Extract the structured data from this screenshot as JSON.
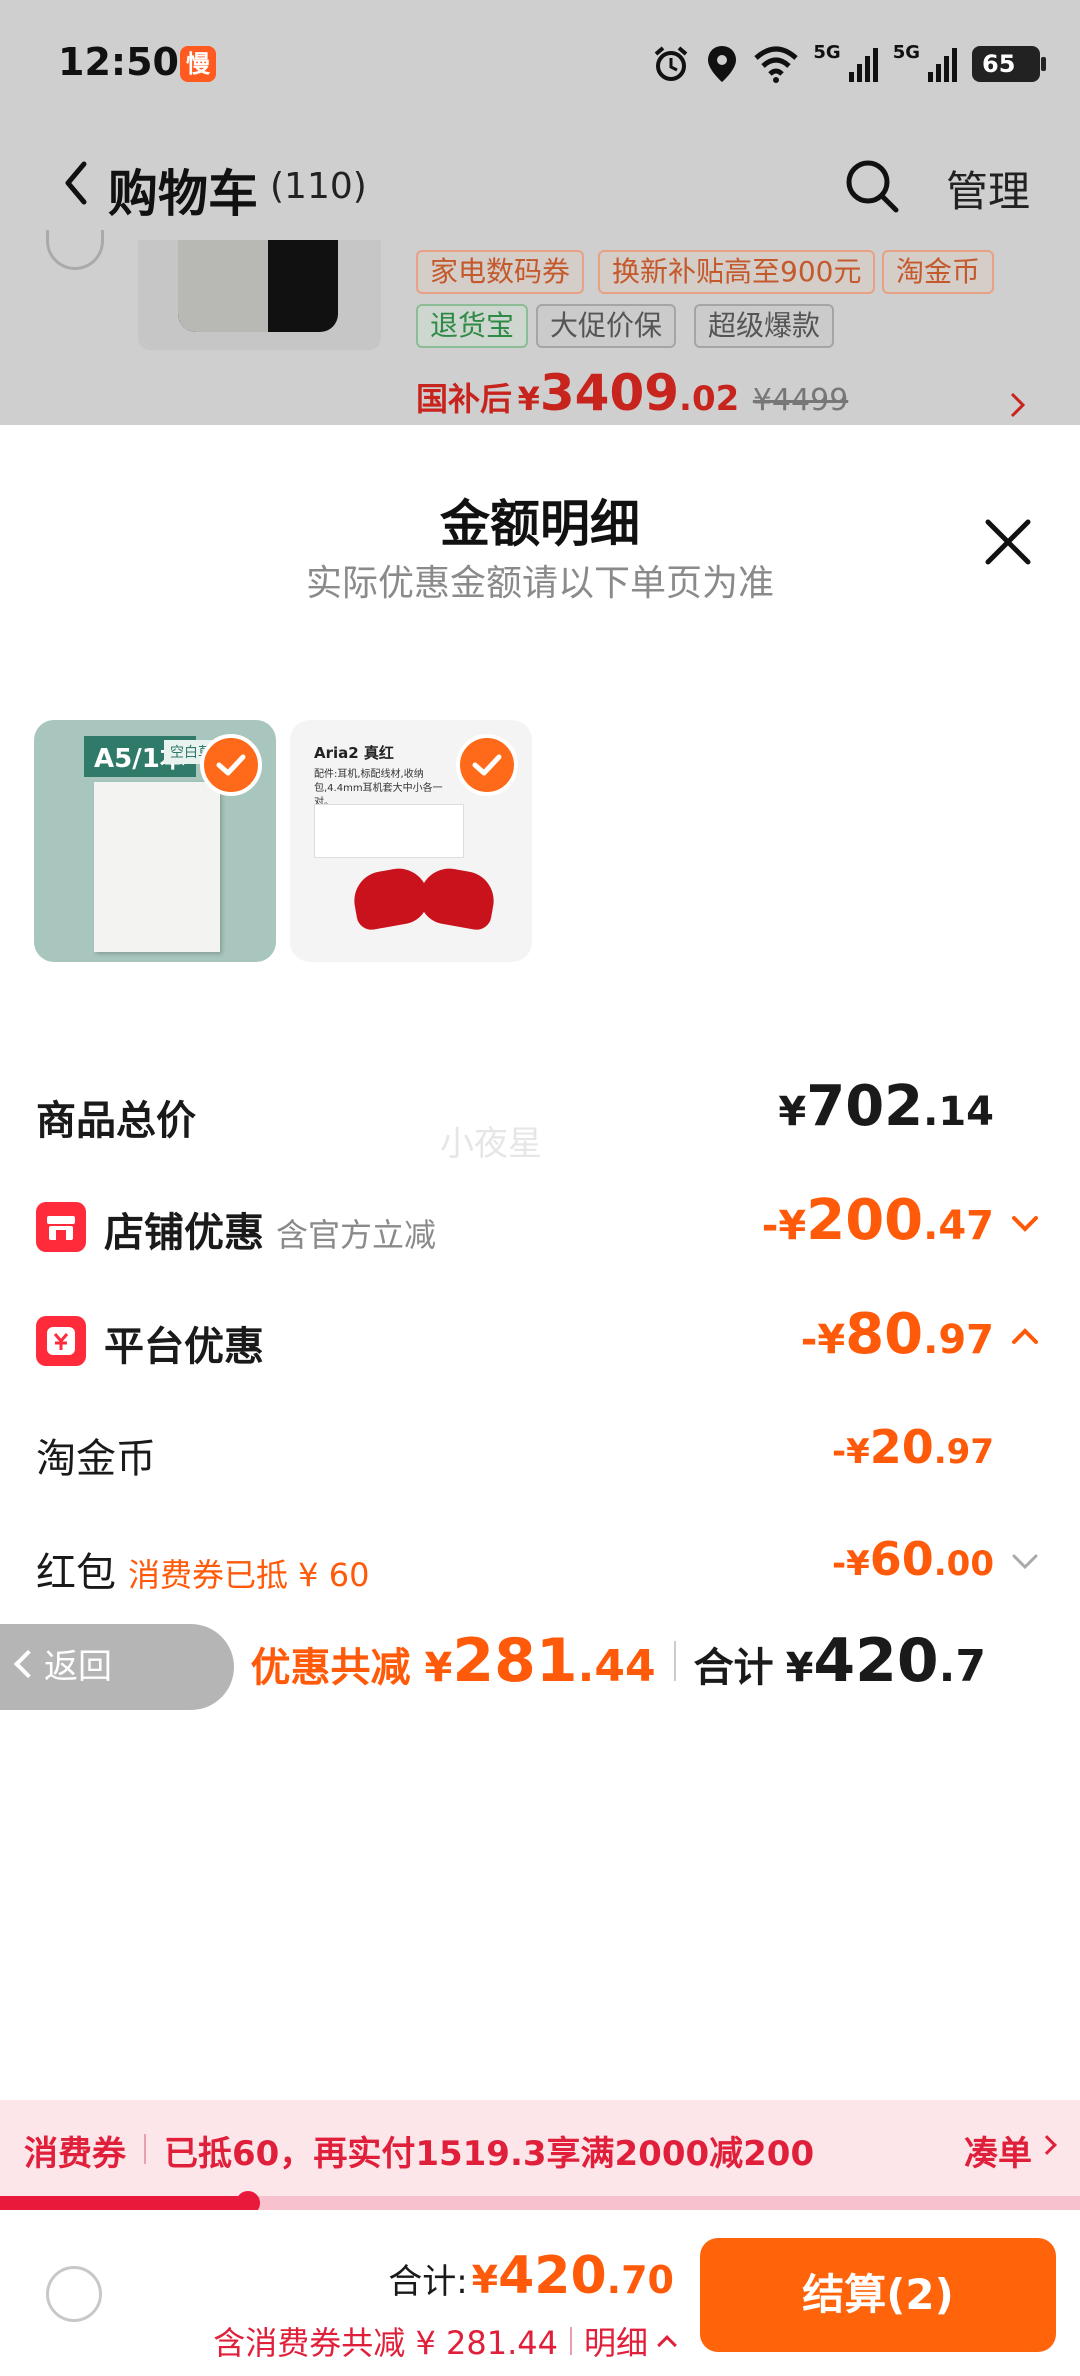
{
  "status_bar": {
    "time": "12:50",
    "slow_badge": "慢",
    "network_1": "5G",
    "network_2": "5G",
    "battery": "65",
    "icons": [
      "alarm-icon",
      "location-icon",
      "wifi-icon",
      "signal-icon",
      "signal-icon",
      "battery-icon"
    ]
  },
  "header": {
    "title": "购物车",
    "count": "(110)",
    "manage_label": "管理",
    "icons": [
      "back-chevron-icon",
      "search-icon"
    ]
  },
  "bg_item": {
    "tags": [
      {
        "text": "家电数码券",
        "style": "orange"
      },
      {
        "text": "换新补贴高至900元",
        "style": "orange"
      },
      {
        "text": "淘金币",
        "style": "orange"
      },
      {
        "text": "退货宝",
        "style": "green"
      },
      {
        "text": "大促价保",
        "style": "gray"
      },
      {
        "text": "超级爆款",
        "style": "gray"
      }
    ],
    "price_label": "国补后",
    "price_yen": "¥",
    "price_int": "3409",
    "price_dec": ".02",
    "price_orig": "¥4499"
  },
  "sheet": {
    "title": "金额明细",
    "subtitle": "实际优惠金额请以下单页为准",
    "watermark": "小夜星",
    "products": [
      {
        "label": "A5/1本",
        "tag": "空白草稿",
        "checked": true
      },
      {
        "title": "Aria2 真红",
        "desc": "配件:耳机,标配线材,收纳包,4.4mm耳机套大中小各一对。",
        "checked": true
      }
    ],
    "rows": {
      "goods_total": {
        "label": "商品总价",
        "yen": "¥",
        "int": "702",
        "dec": ".14"
      },
      "shop_discount": {
        "label": "店铺优惠",
        "note": "含官方立减",
        "yen": "-¥",
        "int": "200",
        "dec": ".47"
      },
      "platform_discount": {
        "label": "平台优惠",
        "yen": "-¥",
        "int": "80",
        "dec": ".97"
      },
      "taojinbi": {
        "label": "淘金币",
        "yen": "-¥",
        "int": "20",
        "dec": ".97"
      },
      "red_packet": {
        "label": "红包",
        "note": "消费券已抵 ¥ 60",
        "yen": "-¥",
        "int": "60",
        "dec": ".00"
      }
    },
    "back_label": "返回",
    "discount_total_label": "优惠共减",
    "discount_total_yen": "¥",
    "discount_total_int": "281",
    "discount_total_dec": ".44",
    "sum_label": "合计",
    "sum_yen": "¥",
    "sum_int": "420",
    "sum_dec": ".7"
  },
  "voucher": {
    "title": "消费券",
    "text": "已抵60，再实付1519.3享满2000减200",
    "link": "凑单",
    "progress": 0.23
  },
  "bottom_bar": {
    "total_label": "合计:",
    "total_yen": "¥",
    "total_int": "420",
    "total_dec": ".70",
    "sub_text": "含消费券共减 ¥ 281.44",
    "detail_label": "明细",
    "checkout_label": "结算(2)"
  },
  "colors": {
    "accent_orange": "#ff5a0a",
    "voucher_red": "#e0203a",
    "checkout_bg": "#ff640a",
    "overlay_gray": "#cfcfcf"
  }
}
